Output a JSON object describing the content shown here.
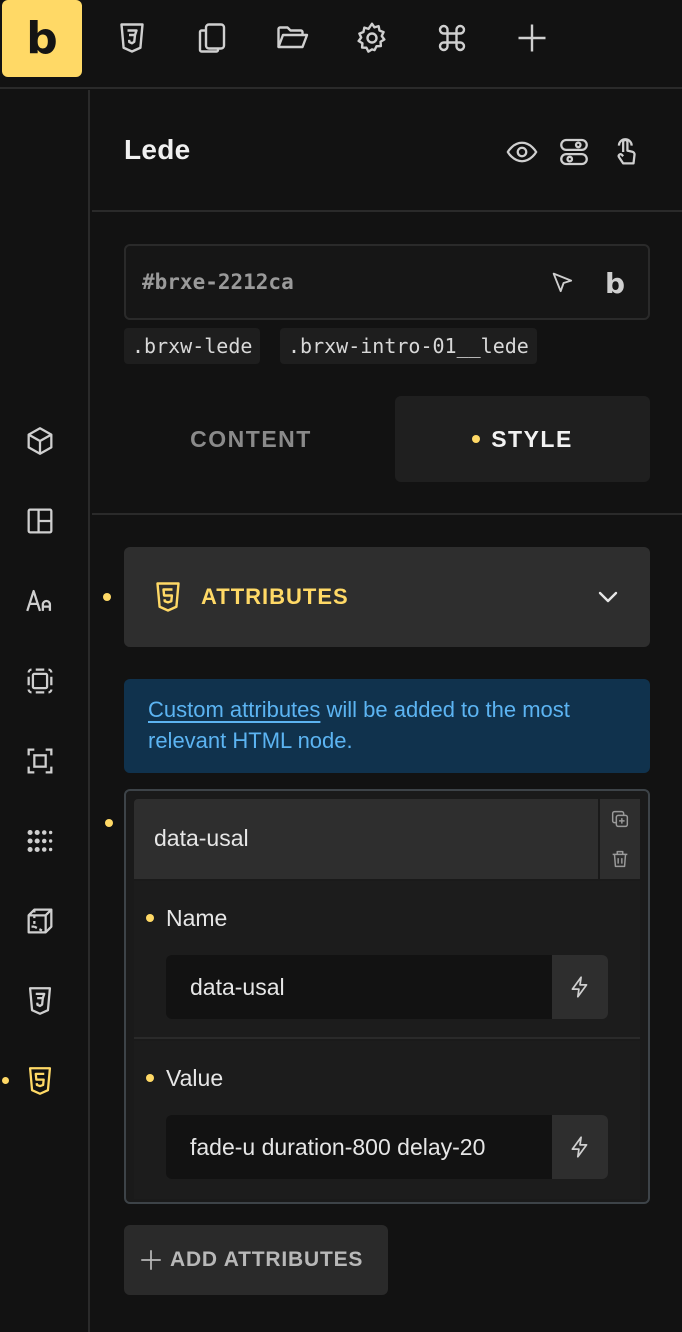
{
  "topbar": {
    "brand_letter": "b",
    "icons": [
      "css3-icon",
      "pages-icon",
      "folder-open-icon",
      "settings-gear-icon",
      "command-icon",
      "add-icon"
    ]
  },
  "leftbar": {
    "icons": [
      "layout-cube-icon",
      "layout-grid-icon",
      "typography-icon",
      "border-icon",
      "spacing-icon",
      "effects-dots-icon",
      "transform-cube-icon",
      "css3-icon",
      "html5-icon"
    ],
    "active": "html5-icon"
  },
  "panel": {
    "title": "Lede",
    "header_icons": [
      "eye-icon",
      "toggle-icon",
      "touch-pointer-icon"
    ]
  },
  "selector": {
    "id": "#brxe-2212ca",
    "classes": [
      ".brxw-lede",
      ".brxw-intro-01__lede"
    ]
  },
  "tabs": {
    "content": "CONTENT",
    "style": "STYLE"
  },
  "attributes_section": {
    "title": "ATTRIBUTES",
    "info_link": "Custom attributes",
    "info_rest": " will be added to the most relevant HTML node."
  },
  "attribute_item": {
    "header": "data-usal",
    "name_label": "Name",
    "name_value": "data-usal",
    "value_label": "Value",
    "value_value": "fade-u duration-800 delay-20"
  },
  "add_button": "ADD ATTRIBUTES",
  "colors": {
    "accent": "#ffd966",
    "info_bg": "#10324d",
    "info_text": "#5cb4f2",
    "background": "#121212"
  }
}
